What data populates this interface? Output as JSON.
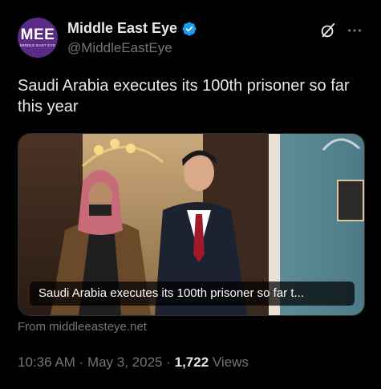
{
  "account": {
    "logo_text": "MEE",
    "logo_subtext": "MIDDLE EAST EYE",
    "display_name": "Middle East Eye",
    "handle": "@MiddleEastEye",
    "verified": true
  },
  "tweet": {
    "text": "Saudi Arabia executes its 100th prisoner so far this year"
  },
  "link_card": {
    "caption": "Saudi Arabia executes its 100th prisoner so far t...",
    "source": "From middleeasteye.net"
  },
  "meta": {
    "time": "10:36 AM",
    "sep1": " · ",
    "date": "May 3, 2025",
    "sep2": " · ",
    "views_count": "1,722",
    "views_label": " Views"
  },
  "colors": {
    "background": "#000000",
    "text_primary": "#e7e9ea",
    "text_secondary": "#71767b",
    "verified_blue": "#1d9bf0",
    "avatar_purple": "#5b2a86"
  },
  "icons": [
    "verified-badge-icon",
    "grok-icon",
    "more-options-icon"
  ]
}
